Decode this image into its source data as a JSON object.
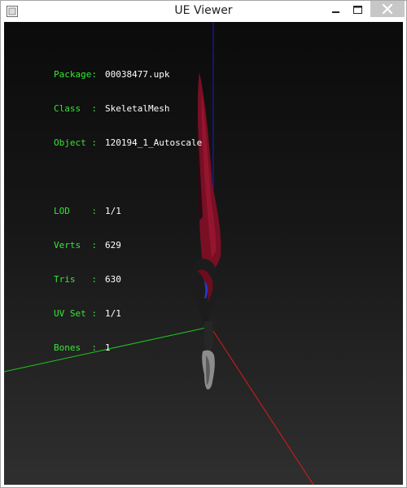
{
  "window": {
    "title": "UE Viewer",
    "icons": {
      "app": "app-icon",
      "minimize": "minimize-icon",
      "maximize": "maximize-icon",
      "close": "close-icon"
    }
  },
  "info": {
    "group1": [
      {
        "label": "Package:",
        "value": "00038477.upk"
      },
      {
        "label": "Class  :",
        "value": "SkeletalMesh"
      },
      {
        "label": "Object :",
        "value": "120194_1_Autoscale"
      }
    ],
    "group2": [
      {
        "label": "LOD    :",
        "value": "1/1"
      },
      {
        "label": "Verts  :",
        "value": "629"
      },
      {
        "label": "Tris   :",
        "value": "630"
      },
      {
        "label": "UV Set :",
        "value": "1/1"
      },
      {
        "label": "Bones  :",
        "value": "1"
      }
    ]
  },
  "colors": {
    "label_text": "#37e637",
    "value_text": "#ffffff",
    "axis_x": "#e11a1a",
    "axis_y": "#1ec81e",
    "axis_z": "#1a1ad6",
    "blade": "#7a0f24",
    "hilt": "#1c1c1c",
    "grip": "#8c8c8c"
  }
}
